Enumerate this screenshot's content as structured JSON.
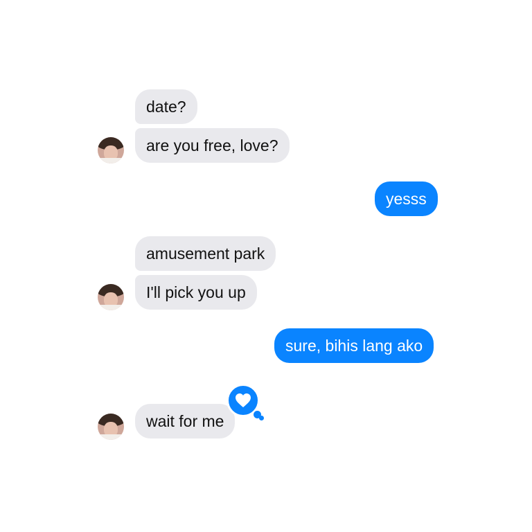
{
  "messages": [
    {
      "text": "date?"
    },
    {
      "text": "are you free, love?"
    },
    {
      "text": "yesss"
    },
    {
      "text": "amusement park"
    },
    {
      "text": "I'll pick you up"
    },
    {
      "text": "sure, bihis lang ako"
    },
    {
      "text": "wait for me"
    }
  ],
  "reaction": {
    "icon": "heart-icon",
    "color": "#0a84ff"
  },
  "colors": {
    "sent_bubble": "#0a84ff",
    "received_bubble": "#e9e9ed",
    "background": "#ffffff"
  }
}
